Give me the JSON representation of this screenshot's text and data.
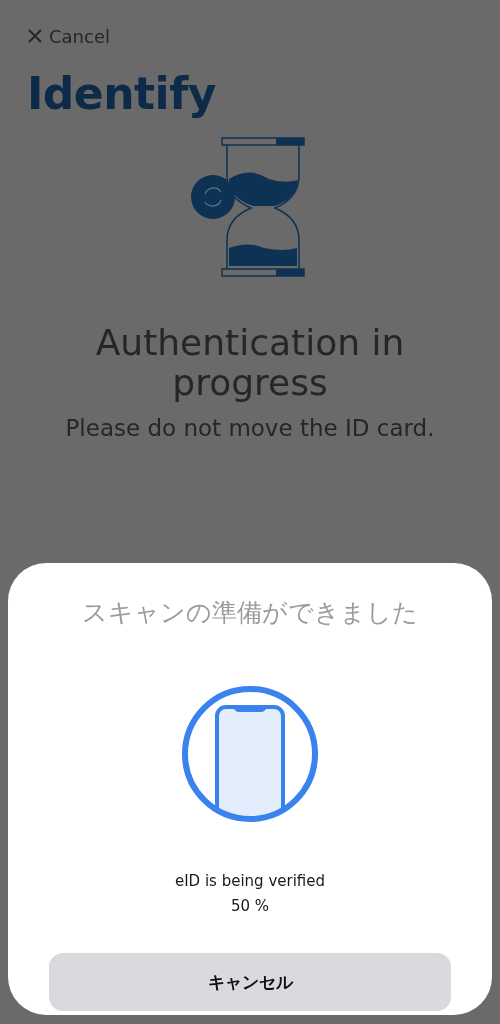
{
  "header": {
    "cancel": "Cancel",
    "title": "Identify"
  },
  "status": {
    "heading": "Authentication in progress",
    "message": "Please do not move the ID card."
  },
  "sheet": {
    "title": "スキャンの準備ができました",
    "status": "eID is being verified",
    "progress": "50 %",
    "button": "キャンセル"
  }
}
